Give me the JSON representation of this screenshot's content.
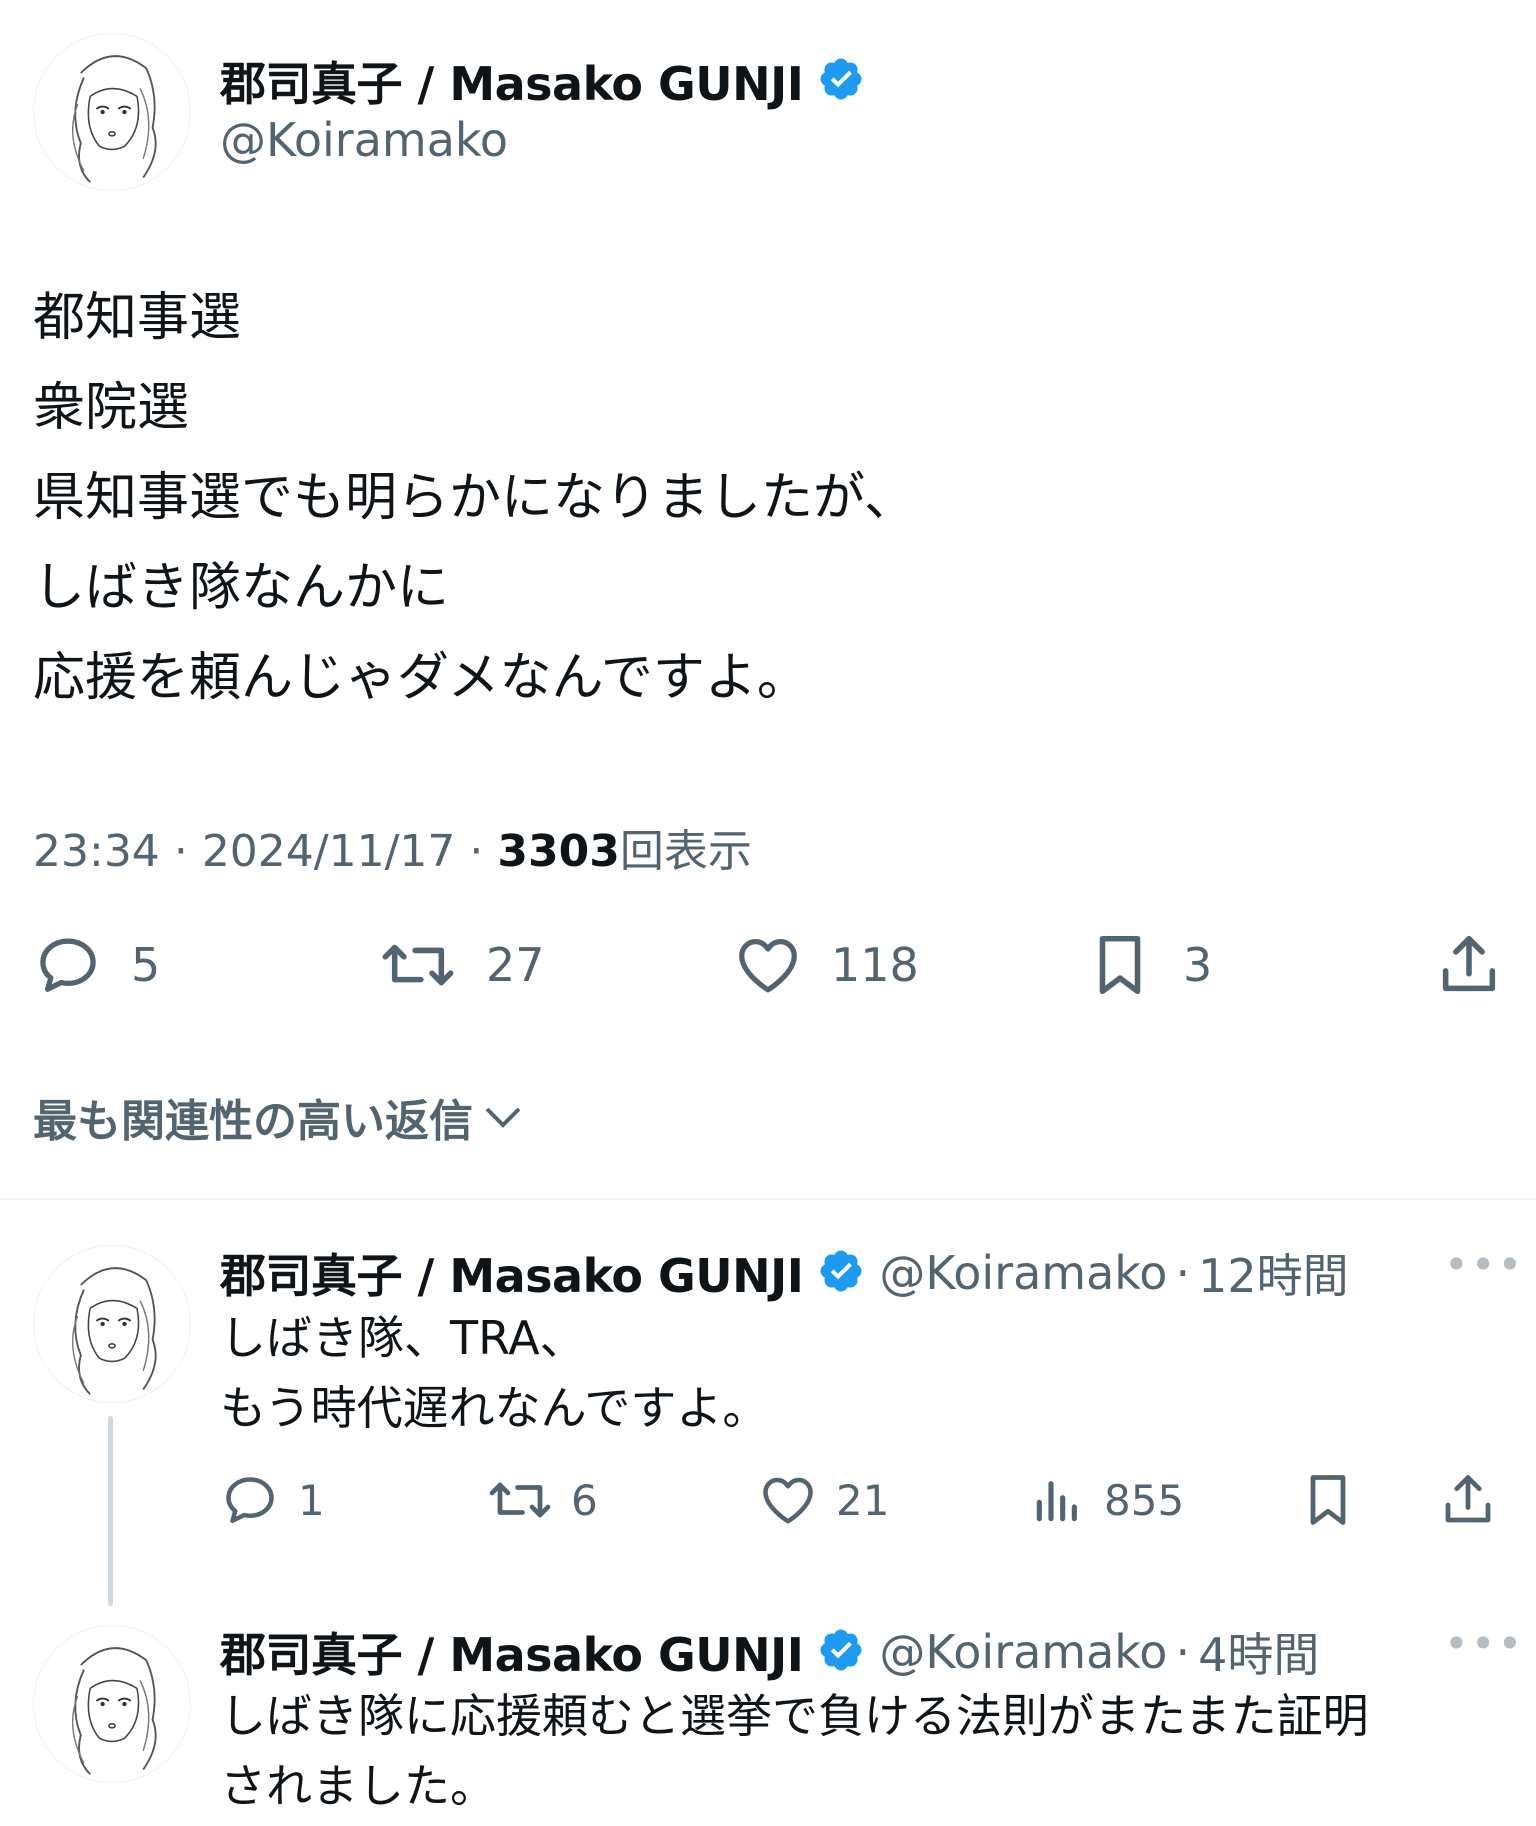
{
  "tweet": {
    "author_name": "郡司真子 / Masako GUNJI",
    "handle": "@Koiramako",
    "body": "都知事選\n衆院選\n県知事選でも明らかになりましたが、\nしばき隊なんかに\n応援を頼んじゃダメなんですよ。",
    "time": "23:34",
    "date": "2024/11/17",
    "sep": "·",
    "views_count": "3303",
    "views_label": "回表示",
    "replies": "5",
    "retweets": "27",
    "likes": "118",
    "bookmarks": "3"
  },
  "sort_label": "最も関連性の高い返信",
  "replies": [
    {
      "author_name": "郡司真子 / Masako GUNJI",
      "handle": "@Koiramako",
      "time_ago": "12時間",
      "body": "しばき隊、TRA、\nもう時代遅れなんですよ。",
      "replies": "1",
      "retweets": "6",
      "likes": "21",
      "views": "855"
    },
    {
      "author_name": "郡司真子 / Masako GUNJI",
      "handle": "@Koiramako",
      "time_ago": "4時間",
      "body": "しばき隊に応援頼むと選挙で負ける法則がまたまた証明\nされました。"
    }
  ],
  "colors": {
    "verified": "#1d9bf0",
    "text": "#0f1419",
    "secondary": "#536471",
    "divider": "#eff3f4"
  },
  "icons": [
    "verified-badge-icon",
    "reply-icon",
    "retweet-icon",
    "like-icon",
    "bookmark-icon",
    "share-icon",
    "views-icon",
    "chevron-down-icon",
    "more-icon"
  ]
}
